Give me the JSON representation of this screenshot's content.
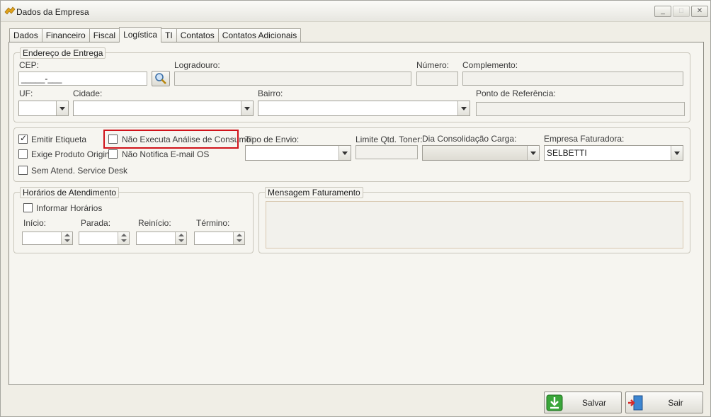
{
  "window": {
    "title": "Dados da Empresa",
    "minimize_glyph": "_",
    "maximize_glyph": "□",
    "close_glyph": "✕"
  },
  "tabs": [
    "Dados",
    "Financeiro",
    "Fiscal",
    "Logística",
    "TI",
    "Contatos",
    "Contatos Adicionais"
  ],
  "active_tab": "Logística",
  "endereco": {
    "group_title": "Endereço de Entrega",
    "cep_label": "CEP:",
    "cep_value": "_____-___",
    "logradouro_label": "Logradouro:",
    "numero_label": "Número:",
    "complemento_label": "Complemento:",
    "uf_label": "UF:",
    "cidade_label": "Cidade:",
    "bairro_label": "Bairro:",
    "ponto_label": "Ponto de Referência:"
  },
  "opcoes": {
    "emitir_etiqueta": "Emitir Etiqueta",
    "exige_produto": "Exige Produto Original",
    "sem_atend": "Sem Atend. Service Desk",
    "nao_executa": "Não Executa Análise de Consumo",
    "nao_notifica": "Não Notifica E-mail OS",
    "tipo_envio_label": "Tipo de Envio:",
    "limite_label": "Limite Qtd. Toner:",
    "dia_label": "Dia Consolidação Carga:",
    "empresa_label": "Empresa Faturadora:",
    "empresa_value": "SELBETTI"
  },
  "horarios": {
    "group_title": "Horários de Atendimento",
    "informar": "Informar Horários",
    "inicio": "Início:",
    "parada": "Parada:",
    "reinicio": "Reinício:",
    "termino": "Término:"
  },
  "mensagem": {
    "group_title": "Mensagem Faturamento"
  },
  "buttons": {
    "salvar": "Salvar",
    "sair": "Sair"
  },
  "colors": {
    "highlight": "#d0131a",
    "background": "#f0eee6"
  }
}
